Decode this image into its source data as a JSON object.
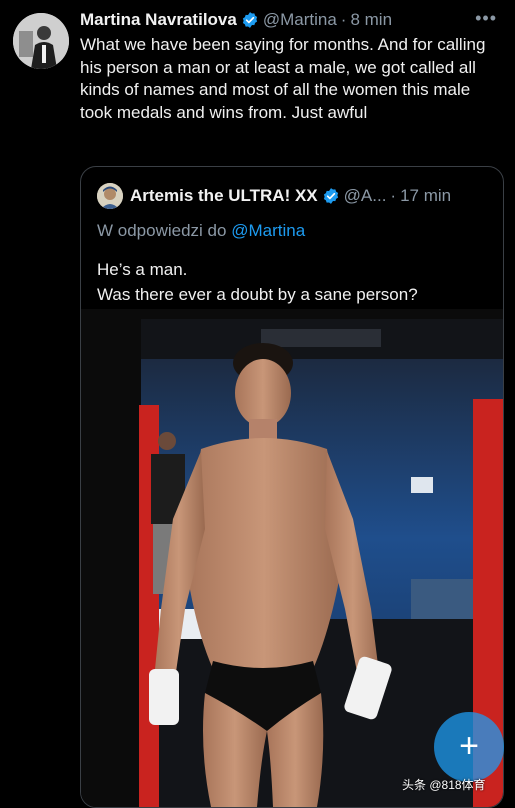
{
  "post": {
    "author_name": "Martina Navratilova",
    "handle": "@Martina",
    "separator": "·",
    "time": "8 min",
    "more_icon": "more-dots-icon",
    "text": "What we have been saying for months. And for calling his person a man or at least a male, we got called all kinds of names and most of all the women this male took medals and wins from. Just awful"
  },
  "quote": {
    "author_name": "Artemis the ULTRA! XX",
    "handle": "@A...",
    "separator": "·",
    "time": "17 min",
    "reply_prefix": "W odpowiedzi do",
    "reply_mention": "@Martina",
    "text_line1": "He’s a man.",
    "text_line2": "Was there ever a doubt by a sane person?"
  },
  "compose_button": {
    "icon": "plus-icon",
    "label": "+"
  },
  "watermark": "头条 @818体育",
  "colors": {
    "background": "#000000",
    "accent": "#1d9bf0",
    "secondary_text": "#8b98a5",
    "border": "#3a3f45"
  }
}
